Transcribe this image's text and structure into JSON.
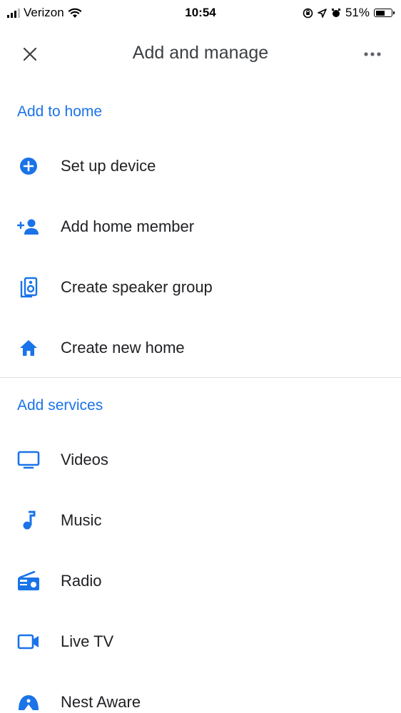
{
  "status_bar": {
    "carrier": "Verizon",
    "time": "10:54",
    "battery": "51%"
  },
  "app_bar": {
    "title": "Add and manage",
    "close_icon": "close-icon",
    "more_icon": "more-horiz-icon"
  },
  "colors": {
    "accent": "#1a73e8",
    "text": "#202124",
    "divider": "#e0e0e0"
  },
  "add_to_home": {
    "header": "Add to home",
    "items": [
      {
        "label": "Set up device",
        "icon": "add-circle-icon"
      },
      {
        "label": "Add home member",
        "icon": "person-add-icon"
      },
      {
        "label": "Create speaker group",
        "icon": "speaker-group-icon"
      },
      {
        "label": "Create new home",
        "icon": "home-icon"
      }
    ]
  },
  "add_services": {
    "header": "Add services",
    "items": [
      {
        "label": "Videos",
        "icon": "tv-icon"
      },
      {
        "label": "Music",
        "icon": "music-note-icon"
      },
      {
        "label": "Radio",
        "icon": "radio-icon"
      },
      {
        "label": "Live TV",
        "icon": "videocam-icon"
      },
      {
        "label": "Nest Aware",
        "icon": "nest-aware-icon"
      }
    ]
  }
}
